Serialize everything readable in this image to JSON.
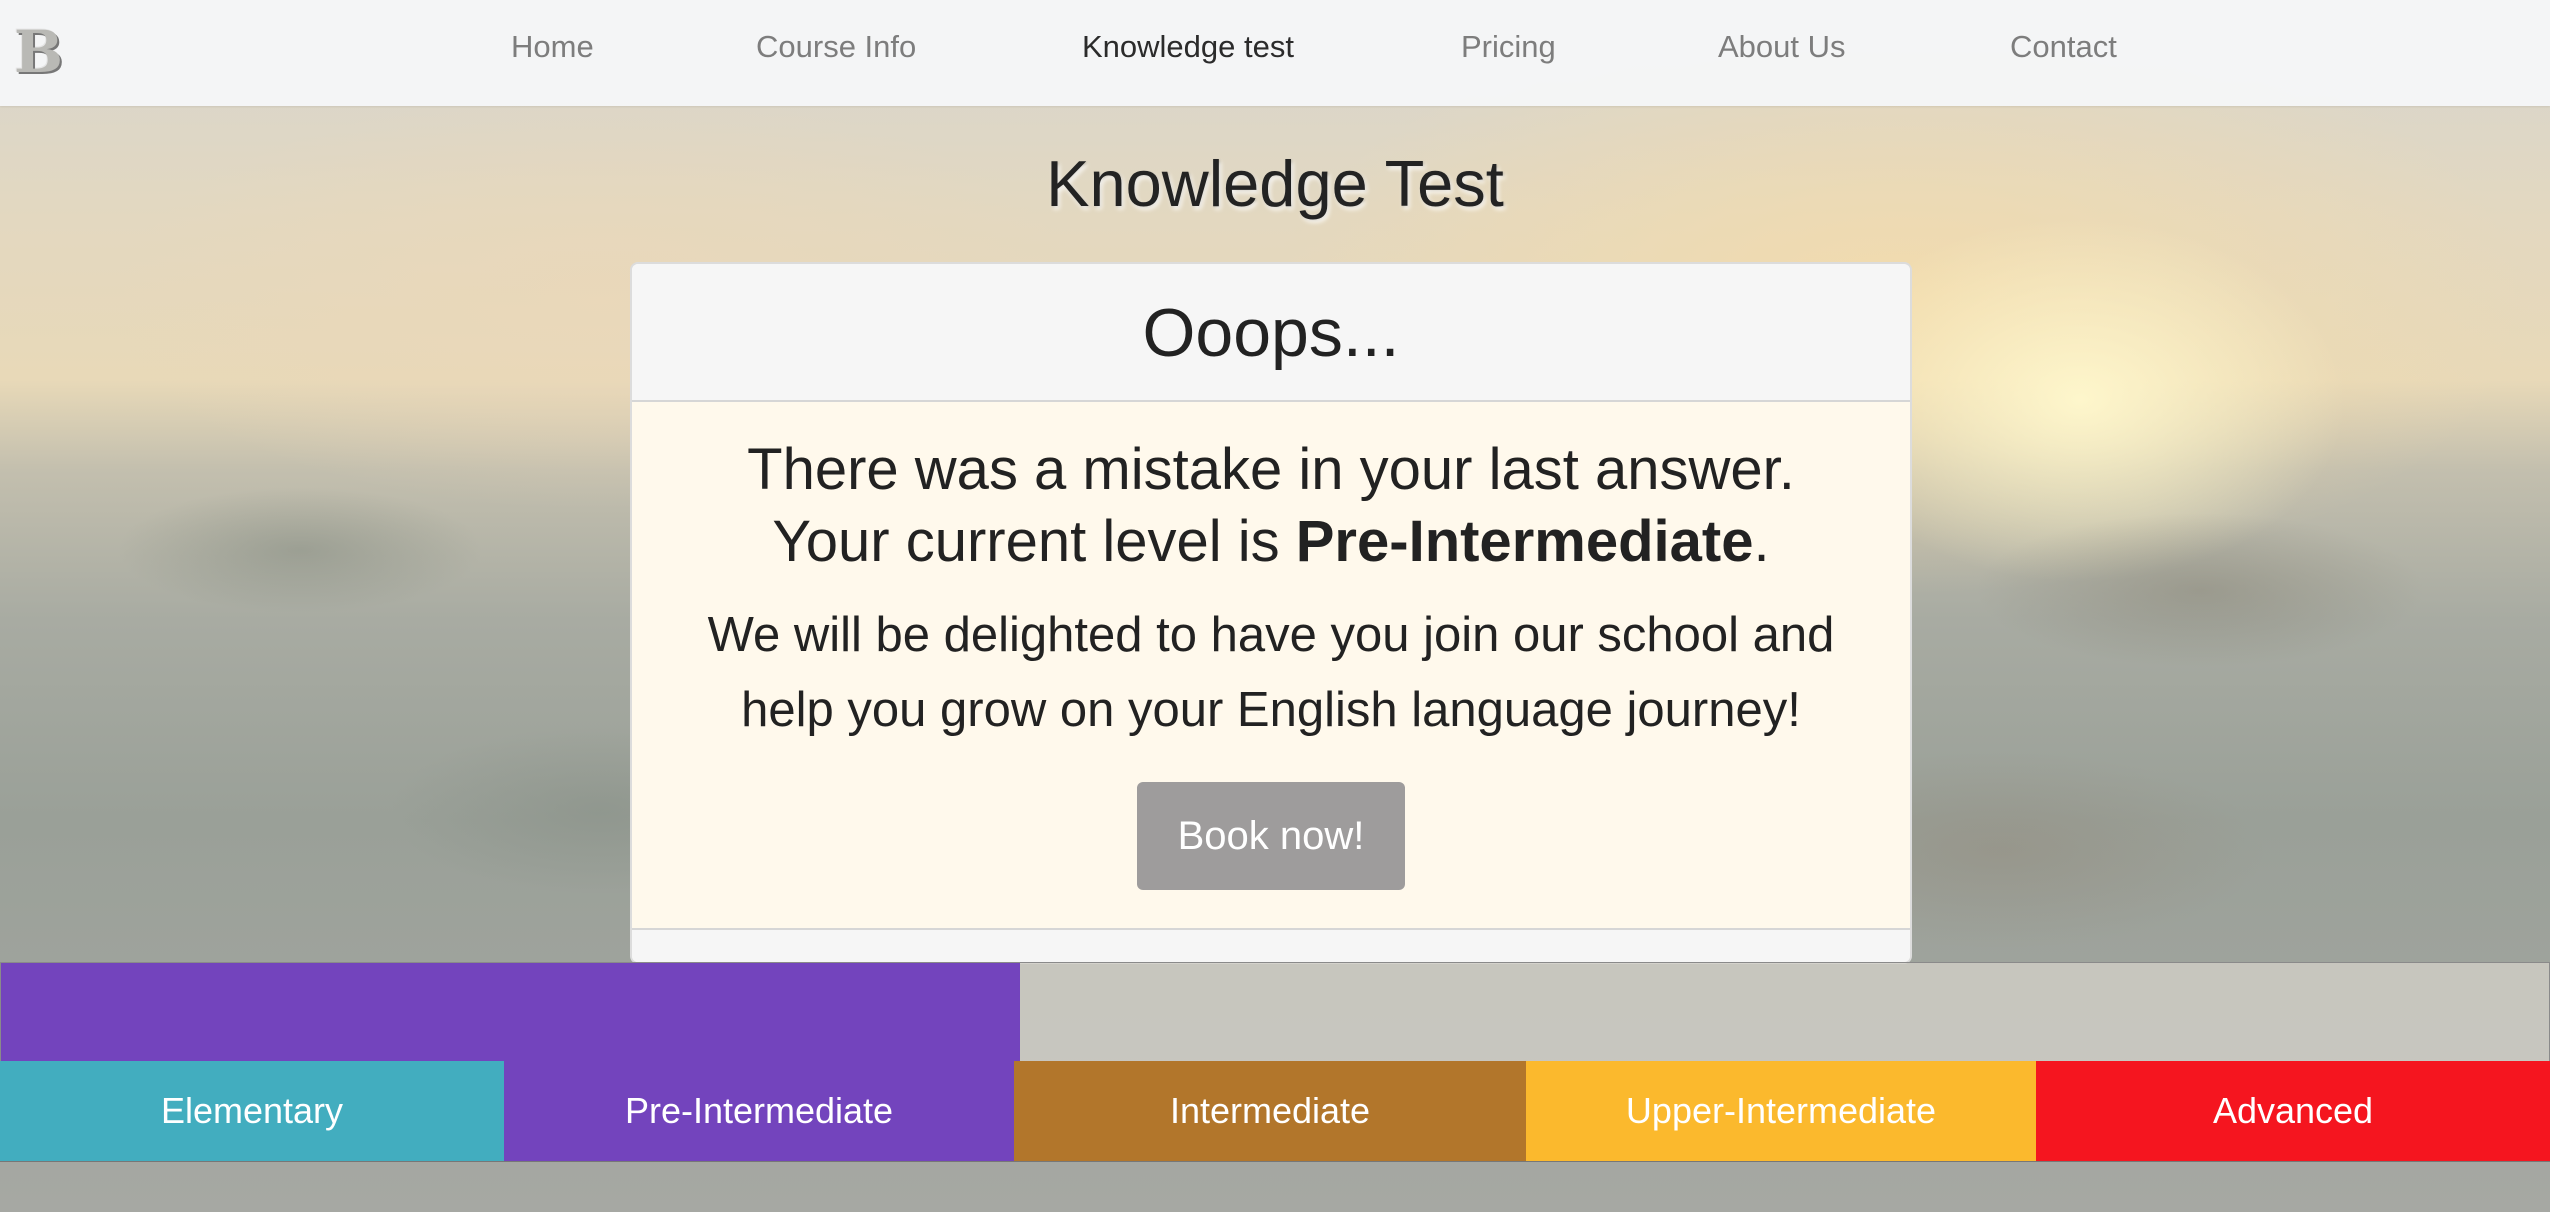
{
  "brand": {
    "logo_text": "B"
  },
  "nav": {
    "items": [
      {
        "label": "Home",
        "active": false
      },
      {
        "label": "Course Info",
        "active": false
      },
      {
        "label": "Knowledge test",
        "active": true
      },
      {
        "label": "Pricing",
        "active": false
      },
      {
        "label": "About Us",
        "active": false
      },
      {
        "label": "Contact",
        "active": false
      }
    ]
  },
  "page": {
    "title": "Knowledge Test"
  },
  "result_card": {
    "header": "Ooops...",
    "line1": "There was a mistake in your last answer.",
    "line2_prefix": "Your current level is ",
    "level": "Pre-Intermediate",
    "line2_suffix": ".",
    "message": "We will be delighted to have you join our school and help you grow on your English language journey!",
    "book_button": "Book now!"
  },
  "progress": {
    "fraction": 0.4,
    "fill_color": "#7344bd"
  },
  "levels": [
    {
      "label": "Elementary",
      "color": "#42adbf"
    },
    {
      "label": "Pre-Intermediate",
      "color": "#7344bd"
    },
    {
      "label": "Intermediate",
      "color": "#b2762b"
    },
    {
      "label": "Upper-Intermediate",
      "color": "#fbb92d"
    },
    {
      "label": "Advanced",
      "color": "#f5151f"
    }
  ]
}
